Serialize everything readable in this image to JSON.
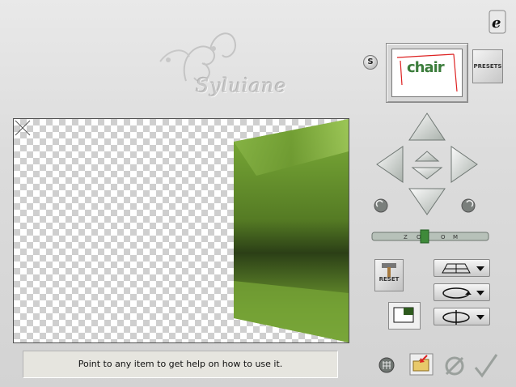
{
  "status": {
    "help_text": "Point to any item to get help on how to use it."
  },
  "watermark": {
    "text": "Syluiane"
  },
  "thumbnail": {
    "word": "chair"
  },
  "buttons": {
    "presets_label": "PRESETS",
    "reset_label": "RESET",
    "s_label": "S"
  },
  "zoom": {
    "letters": [
      "Z",
      "O",
      "O",
      "M"
    ],
    "level": 0.5
  },
  "colors": {
    "shape_green": "#7aa83a",
    "shape_dark": "#2f4a18",
    "checker": "#cfcfcf",
    "panel_bg": "#d9d9d9"
  },
  "icons": [
    "e-logo-icon",
    "s-icon",
    "presets-icon",
    "arrow-up-icon",
    "arrow-down-icon",
    "arrow-left-icon",
    "arrow-right-icon",
    "move-forward-icon",
    "move-back-icon",
    "rotate-left-icon",
    "rotate-right-icon",
    "zoom-slider",
    "reset-icon",
    "grid-plane-icon",
    "rotate-horizontal-icon",
    "rotate-vertical-icon",
    "color-swatch-icon",
    "grid-icon",
    "open-folder-icon",
    "cancel-icon",
    "ok-check-icon"
  ]
}
